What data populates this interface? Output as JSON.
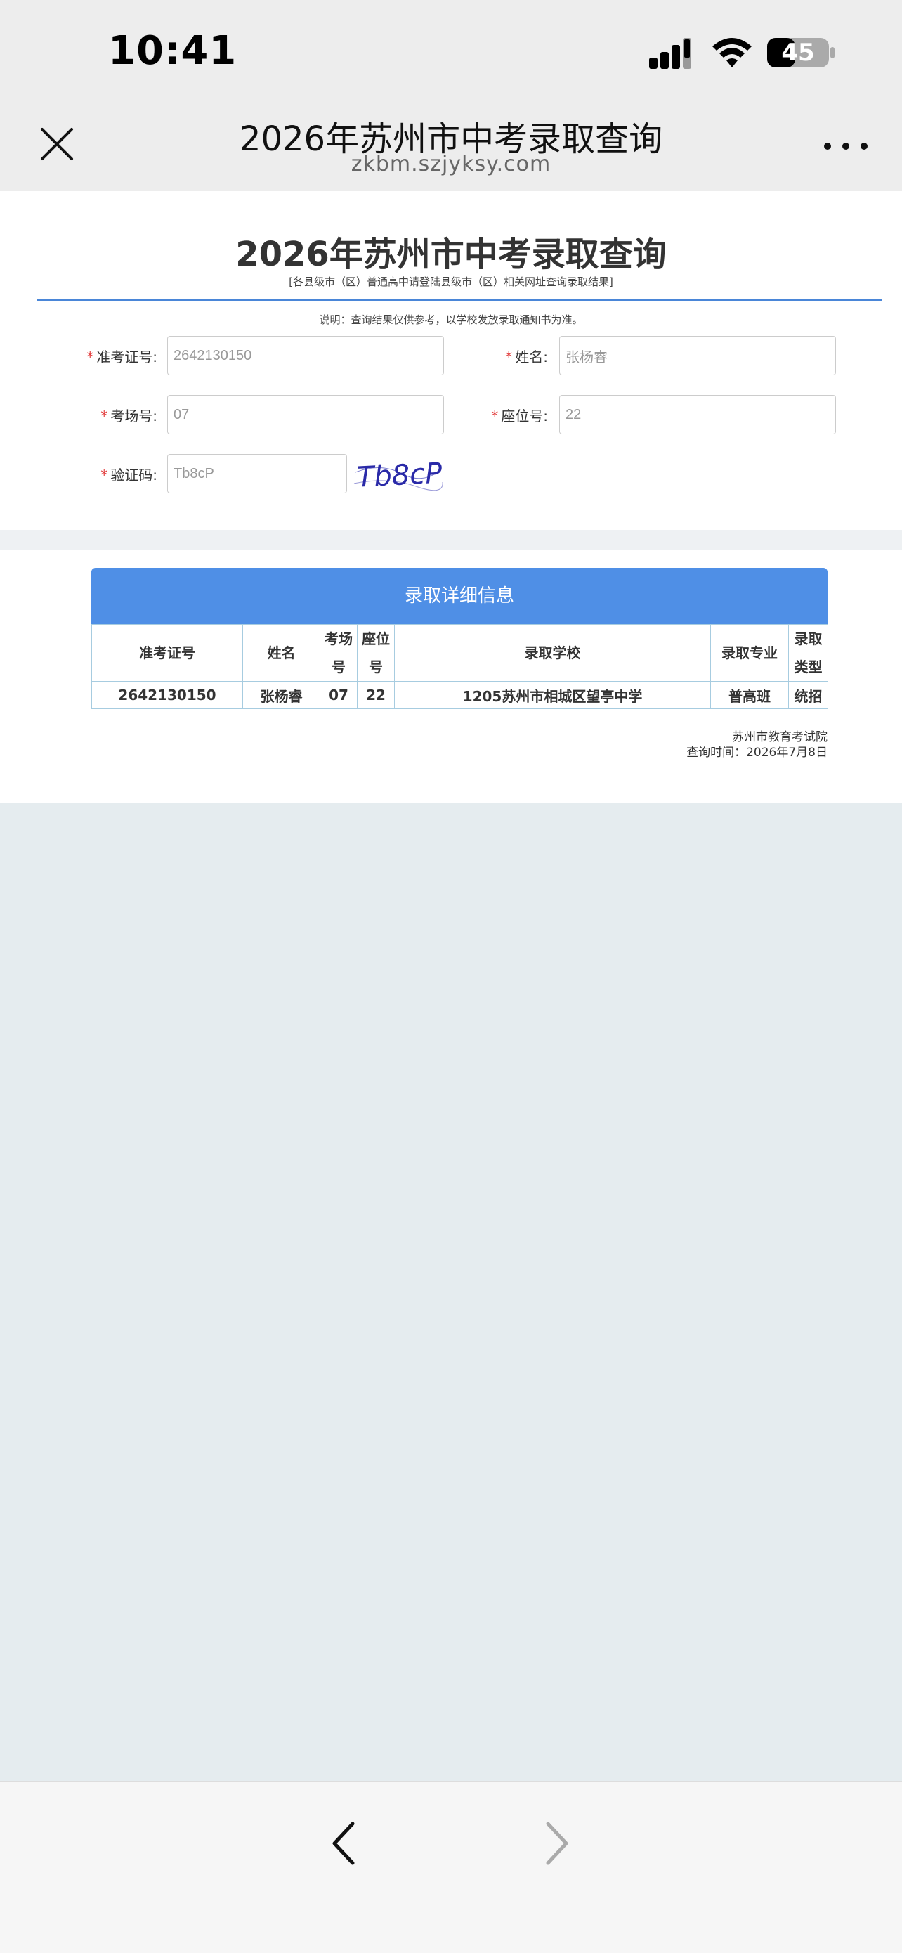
{
  "status_bar": {
    "time": "10:41",
    "battery": "45"
  },
  "nav": {
    "title": "2026年苏州市中考录取查询",
    "url": "zkbm.szjyksy.com"
  },
  "form": {
    "title": "2026年苏州市中考录取查询",
    "subtitle": "[各县级市（区）普通高中请登陆县级市（区）相关网址查询录取结果]",
    "note": "说明：查询结果仅供参考，以学校发放录取通知书为准。",
    "required_mark": "*",
    "fields": [
      {
        "label": "准考证号:",
        "value": "2642130150"
      },
      {
        "label": "姓名:",
        "value": "张杨睿"
      },
      {
        "label": "考场号:",
        "value": "07"
      },
      {
        "label": "座位号:",
        "value": "22"
      },
      {
        "label": "验证码:",
        "value": "Tb8cP"
      }
    ],
    "captcha_text": "Tb8cP"
  },
  "result": {
    "header": "录取详细信息",
    "columns": [
      "准考证号",
      "姓名",
      "考场号",
      "座位号",
      "录取学校",
      "录取专业",
      "录取类型"
    ],
    "row": [
      "2642130150",
      "张杨睿",
      "07",
      "22",
      "1205苏州市相城区望亭中学",
      "普高班",
      "统招"
    ],
    "issuer": "苏州市教育考试院",
    "query_time": "查询时间：2026年7月8日"
  },
  "icons": {
    "close": "close-icon",
    "more": "more-icon",
    "back": "chevron-left-icon",
    "forward": "chevron-right-icon"
  },
  "colors": {
    "accent_blue": "#4f8fe6",
    "required_red": "#e23b3b",
    "table_border": "#a7cce0"
  }
}
